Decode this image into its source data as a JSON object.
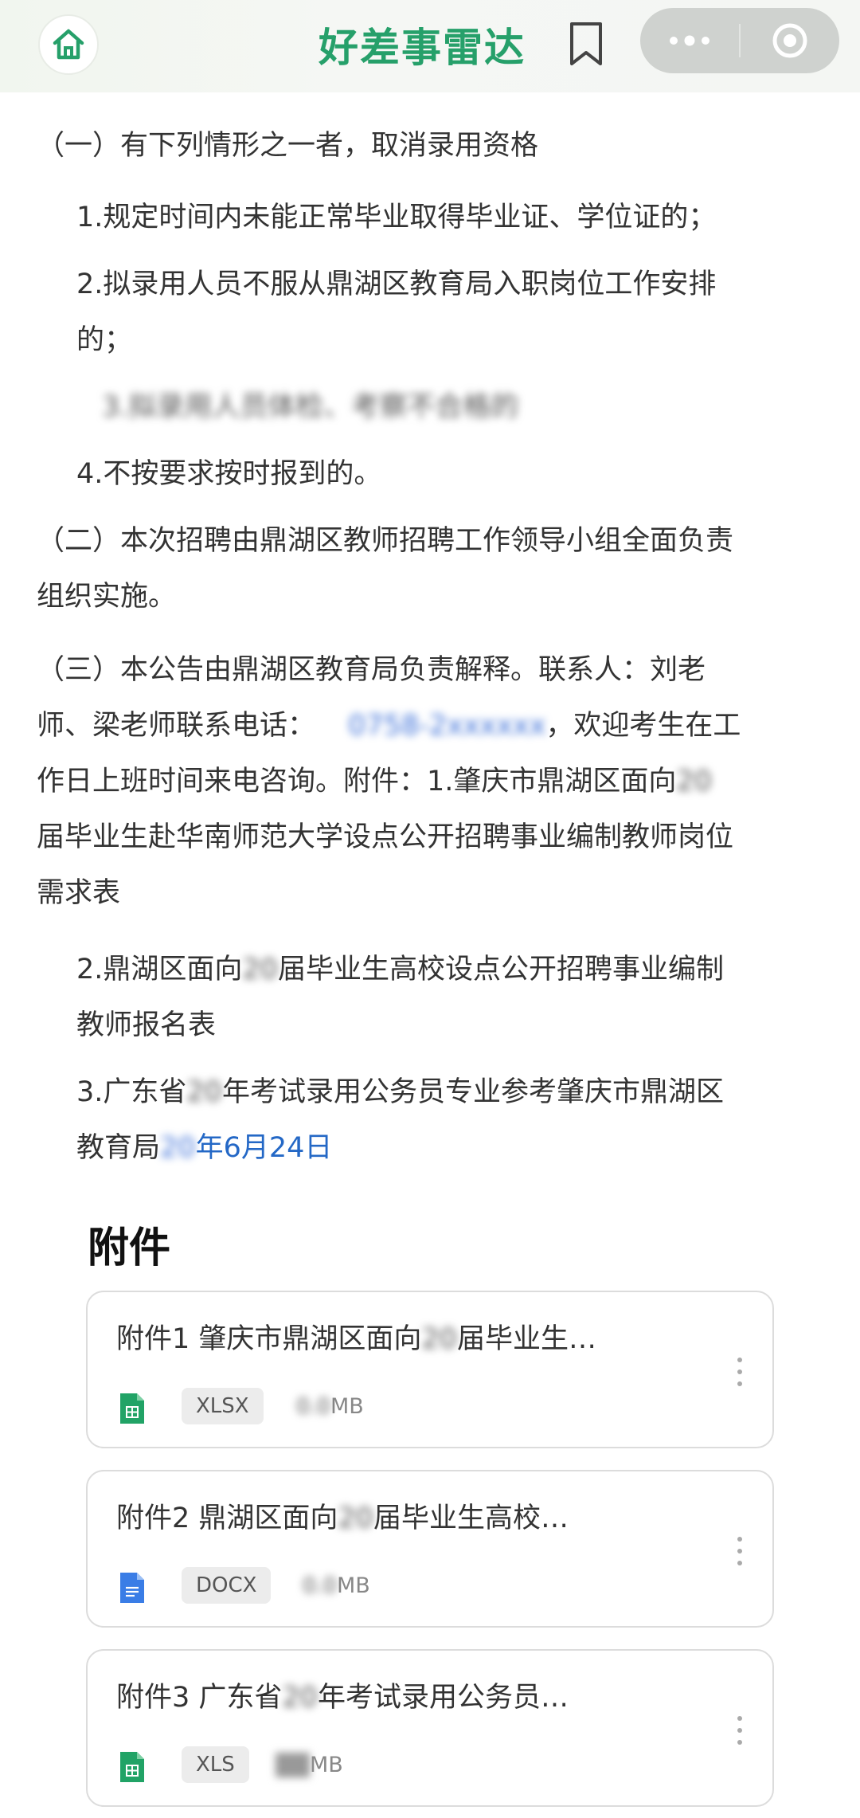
{
  "header": {
    "title": "好差事雷达",
    "home_icon": "home-icon",
    "bookmark_icon": "bookmark-icon",
    "more_icon": "more-dots-icon",
    "close_icon": "target-circle-icon"
  },
  "article": {
    "p1": "（一）有下列情形之一者，取消录用资格",
    "item1": "1.规定时间内未能正常毕业取得毕业证、学位证的；",
    "item2_l1": "2.拟录用人员不服从鼎湖区教育局入职岗位工作安排",
    "item2_l2": "的；",
    "item3_blur": "3.拟录用人员体检、考察不合格的",
    "item4": "4.不按要求按时报到的。",
    "p2_l1": "（二）本次招聘由鼎湖区教师招聘工作领导小组全面负责",
    "p2_l2": "组织实施。",
    "p3_l1": "（三）本公告由鼎湖区教育局负责解释。联系人：刘老",
    "p3_l2a": "师、梁老师联系电话：",
    "p3_l2_phone": "0758-2xxxxxx",
    "p3_l2b": "，欢迎考生在工",
    "p3_l3a": "作日上班时间来电咨询。附件：1.肇庆市鼎湖区面向",
    "p3_l3_blur": "20",
    "p3_l4": "届毕业生赴华南师范大学设点公开招聘事业编制教师岗位",
    "p3_l5": "需求表",
    "a2_l1a": "2.鼎湖区面向",
    "a2_l1_blur": "20",
    "a2_l1b": "届毕业生高校设点公开招聘事业编制",
    "a2_l2": "教师报名表",
    "a3_l1a": "3.广东省",
    "a3_l1_blur": "20",
    "a3_l1b": "年考试录用公务员专业参考肇庆市鼎湖区",
    "a3_l2a": "教育局",
    "a3_l2_blur": "20",
    "a3_l2_date": "年6月24日"
  },
  "attachments": {
    "title": "附件",
    "items": [
      {
        "name_a": "附件1 肇庆市鼎湖区面向",
        "name_blur": "20",
        "name_b": "届毕业生…",
        "ext": "XLSX",
        "size_blur": "0.0",
        "size_unit": "MB",
        "icon": "spreadsheet-file-icon",
        "color": "#21a366"
      },
      {
        "name_a": "附件2 鼎湖区面向",
        "name_blur": "20",
        "name_b": "届毕业生高校…",
        "ext": "DOCX",
        "size_blur": "0.0",
        "size_unit": "MB",
        "icon": "document-file-icon",
        "color": "#3a7de6"
      },
      {
        "name_a": "附件3 广东省",
        "name_blur": "20",
        "name_b": "年考试录用公务员…",
        "ext": "XLS",
        "size_blur": "0.0",
        "size_unit": "MB",
        "icon": "spreadsheet-file-icon",
        "color": "#21a366"
      }
    ]
  },
  "colors": {
    "accent": "#26a06a",
    "link": "#2468c6"
  }
}
